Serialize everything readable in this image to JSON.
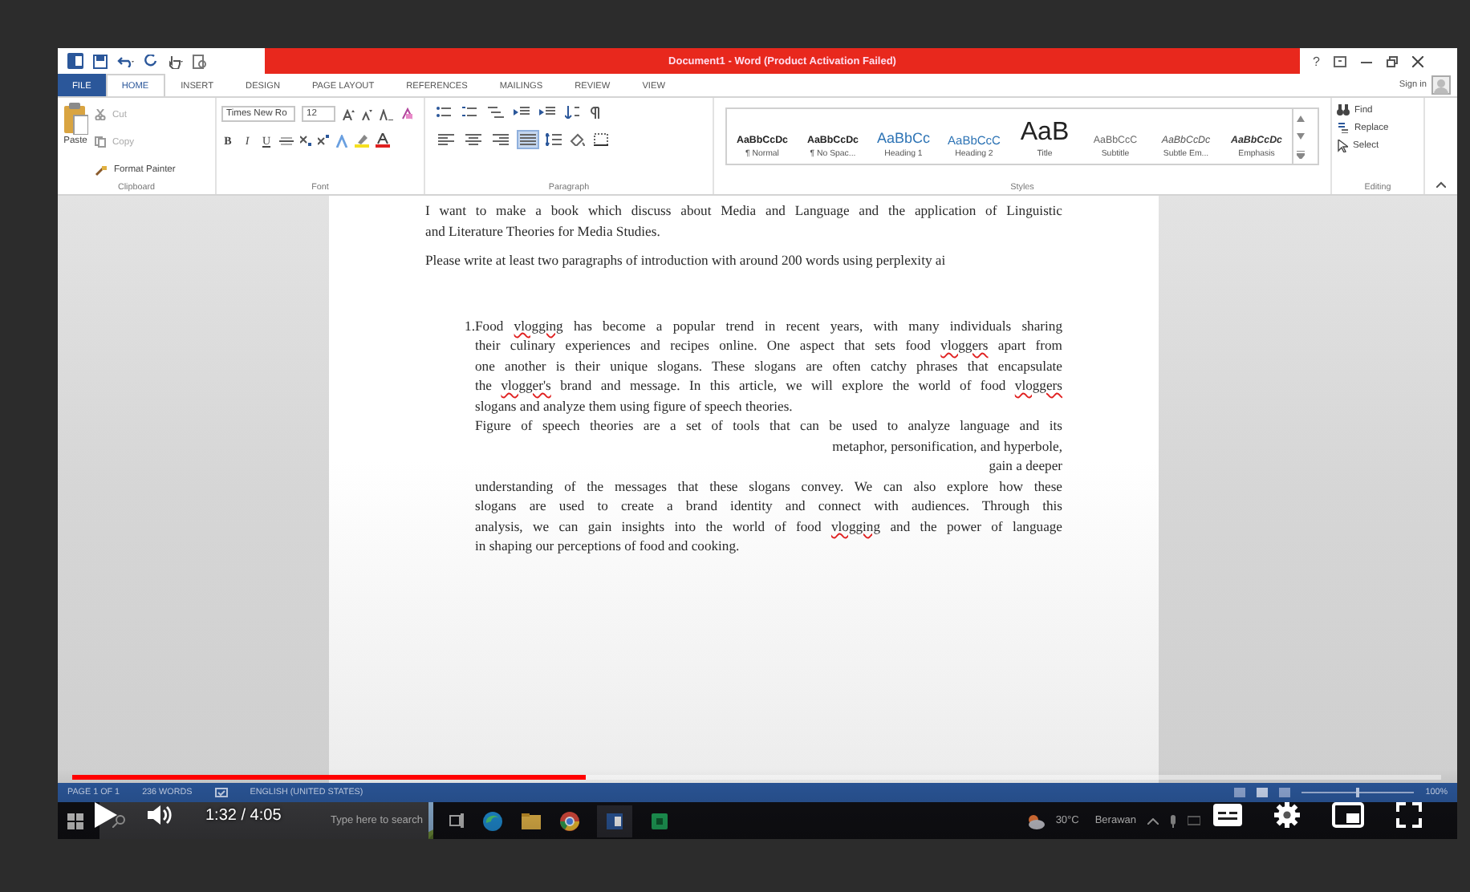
{
  "window": {
    "title": "Document1 - Word (Product Activation Failed)",
    "help": "?"
  },
  "ribbon_tabs": [
    {
      "label": "FILE",
      "kind": "file",
      "selected": false
    },
    {
      "label": "HOME",
      "kind": "tab",
      "selected": true
    },
    {
      "label": "INSERT",
      "kind": "tab",
      "selected": false
    },
    {
      "label": "DESIGN",
      "kind": "tab",
      "selected": false
    },
    {
      "label": "PAGE LAYOUT",
      "kind": "tab",
      "selected": false
    },
    {
      "label": "REFERENCES",
      "kind": "tab",
      "selected": false
    },
    {
      "label": "MAILINGS",
      "kind": "tab",
      "selected": false
    },
    {
      "label": "REVIEW",
      "kind": "tab",
      "selected": false
    },
    {
      "label": "VIEW",
      "kind": "tab",
      "selected": false
    }
  ],
  "sign_in": "Sign in",
  "clipboard": {
    "paste": "Paste",
    "label": "Clipboard",
    "items": [
      {
        "label": "Cut",
        "disabled": true
      },
      {
        "label": "Copy",
        "disabled": true
      },
      {
        "label": "Format Painter",
        "disabled": false
      }
    ]
  },
  "font": {
    "name": "Times New Ro",
    "size": "12",
    "format_buttons": [
      "B",
      "I",
      "U"
    ],
    "label": "Font"
  },
  "paragraph": {
    "label": "Paragraph",
    "align_buttons": [
      {
        "kind": "left",
        "selected": false
      },
      {
        "kind": "center",
        "selected": false
      },
      {
        "kind": "right",
        "selected": false
      },
      {
        "kind": "justify",
        "selected": true
      }
    ]
  },
  "styles": {
    "label": "Styles",
    "items": [
      {
        "preview": "AaBbCcDc",
        "name": "¶ Normal",
        "kind": "normal"
      },
      {
        "preview": "AaBbCcDc",
        "name": "¶ No Spac...",
        "kind": "normal"
      },
      {
        "preview": "AaBbCc",
        "name": "Heading 1",
        "kind": "heading1"
      },
      {
        "preview": "AaBbCcC",
        "name": "Heading 2",
        "kind": "heading2"
      },
      {
        "preview": "AaB",
        "name": "Title",
        "kind": "title"
      },
      {
        "preview": "AaBbCcC",
        "name": "Subtitle",
        "kind": "subtle"
      },
      {
        "preview": "AaBbCcDc",
        "name": "Subtle Em...",
        "kind": "subtle_emphasis"
      },
      {
        "preview": "AaBbCcDc",
        "name": "Emphasis",
        "kind": "emphasis"
      }
    ]
  },
  "editing": {
    "label": "Editing",
    "items": [
      {
        "label": "Find",
        "kind": "find"
      },
      {
        "label": "Replace",
        "kind": "replace"
      },
      {
        "label": "Select",
        "kind": "select"
      }
    ]
  },
  "document": {
    "blocks": [
      {
        "kind": "para",
        "lines": [
          {
            "kind": "justify",
            "segments": [
              {
                "text": "I want to make a book which discuss about Media and Language and the application of Linguistic",
                "misspelled": false
              }
            ]
          },
          {
            "kind": "last",
            "segments": [
              {
                "text": "and Literature Theories for Media Studies.",
                "misspelled": false
              }
            ]
          }
        ]
      },
      {
        "kind": "para",
        "lines": [
          {
            "kind": "last",
            "segments": [
              {
                "text": "Please write at least two paragraphs of introduction with around 200 words using perplexity ai",
                "misspelled": false
              }
            ]
          }
        ]
      },
      {
        "kind": "list_item",
        "number": "1.",
        "lines": [
          {
            "kind": "justify",
            "segments": [
              {
                "text": "Food ",
                "misspelled": false
              },
              {
                "text": "vlogging",
                "misspelled": true
              },
              {
                "text": " has become a popular trend in recent years, with many individuals sharing",
                "misspelled": false
              }
            ]
          },
          {
            "kind": "justify",
            "segments": [
              {
                "text": "their culinary experiences and recipes online. One aspect that sets food ",
                "misspelled": false
              },
              {
                "text": "vloggers",
                "misspelled": true
              },
              {
                "text": " apart from",
                "misspelled": false
              }
            ]
          },
          {
            "kind": "justify",
            "segments": [
              {
                "text": "one another is their unique slogans. These slogans are often catchy phrases that encapsulate",
                "misspelled": false
              }
            ]
          },
          {
            "kind": "justify",
            "segments": [
              {
                "text": "the ",
                "misspelled": false
              },
              {
                "text": "vlogger's",
                "misspelled": true
              },
              {
                "text": " brand and message. In this article, we will explore the world of food ",
                "misspelled": false
              },
              {
                "text": "vloggers",
                "misspelled": true
              }
            ]
          },
          {
            "kind": "last",
            "segments": [
              {
                "text": "slogans and analyze them using figure of speech theories.",
                "misspelled": false
              }
            ]
          },
          {
            "kind": "justify",
            "segments": [
              {
                "text": "Figure of speech theories are a set of tools that can be used to analyze language and its",
                "misspelled": false
              }
            ]
          },
          {
            "kind": "right",
            "segments": [
              {
                "text": "metaphor, personification, and hyperbole,",
                "misspelled": false
              }
            ]
          },
          {
            "kind": "right",
            "segments": [
              {
                "text": "gain a deeper",
                "misspelled": false
              }
            ]
          },
          {
            "kind": "justify",
            "segments": [
              {
                "text": "understanding of the messages that these slogans convey. We can also explore how these",
                "misspelled": false
              }
            ]
          },
          {
            "kind": "justify",
            "segments": [
              {
                "text": "slogans are used to create a brand identity and connect with audiences. Through this",
                "misspelled": false
              }
            ]
          },
          {
            "kind": "justify",
            "segments": [
              {
                "text": "analysis, we can gain insights into the world of food ",
                "misspelled": false
              },
              {
                "text": "vlogging",
                "misspelled": true
              },
              {
                "text": " and the power of language",
                "misspelled": false
              }
            ]
          },
          {
            "kind": "last",
            "segments": [
              {
                "text": "in shaping our perceptions of food and cooking.",
                "misspelled": false
              }
            ]
          }
        ]
      }
    ]
  },
  "status_bar": {
    "page": "PAGE 1 OF 1",
    "words": "236 WORDS",
    "language": "ENGLISH (UNITED STATES)",
    "zoom": "100%"
  },
  "taskbar": {
    "search_placeholder": "Type here to search",
    "temperature": "30°C",
    "condition": "Berawan"
  },
  "player": {
    "time": "1:32 / 4:05",
    "paused": true,
    "progress": {
      "level": 0.375
    }
  }
}
